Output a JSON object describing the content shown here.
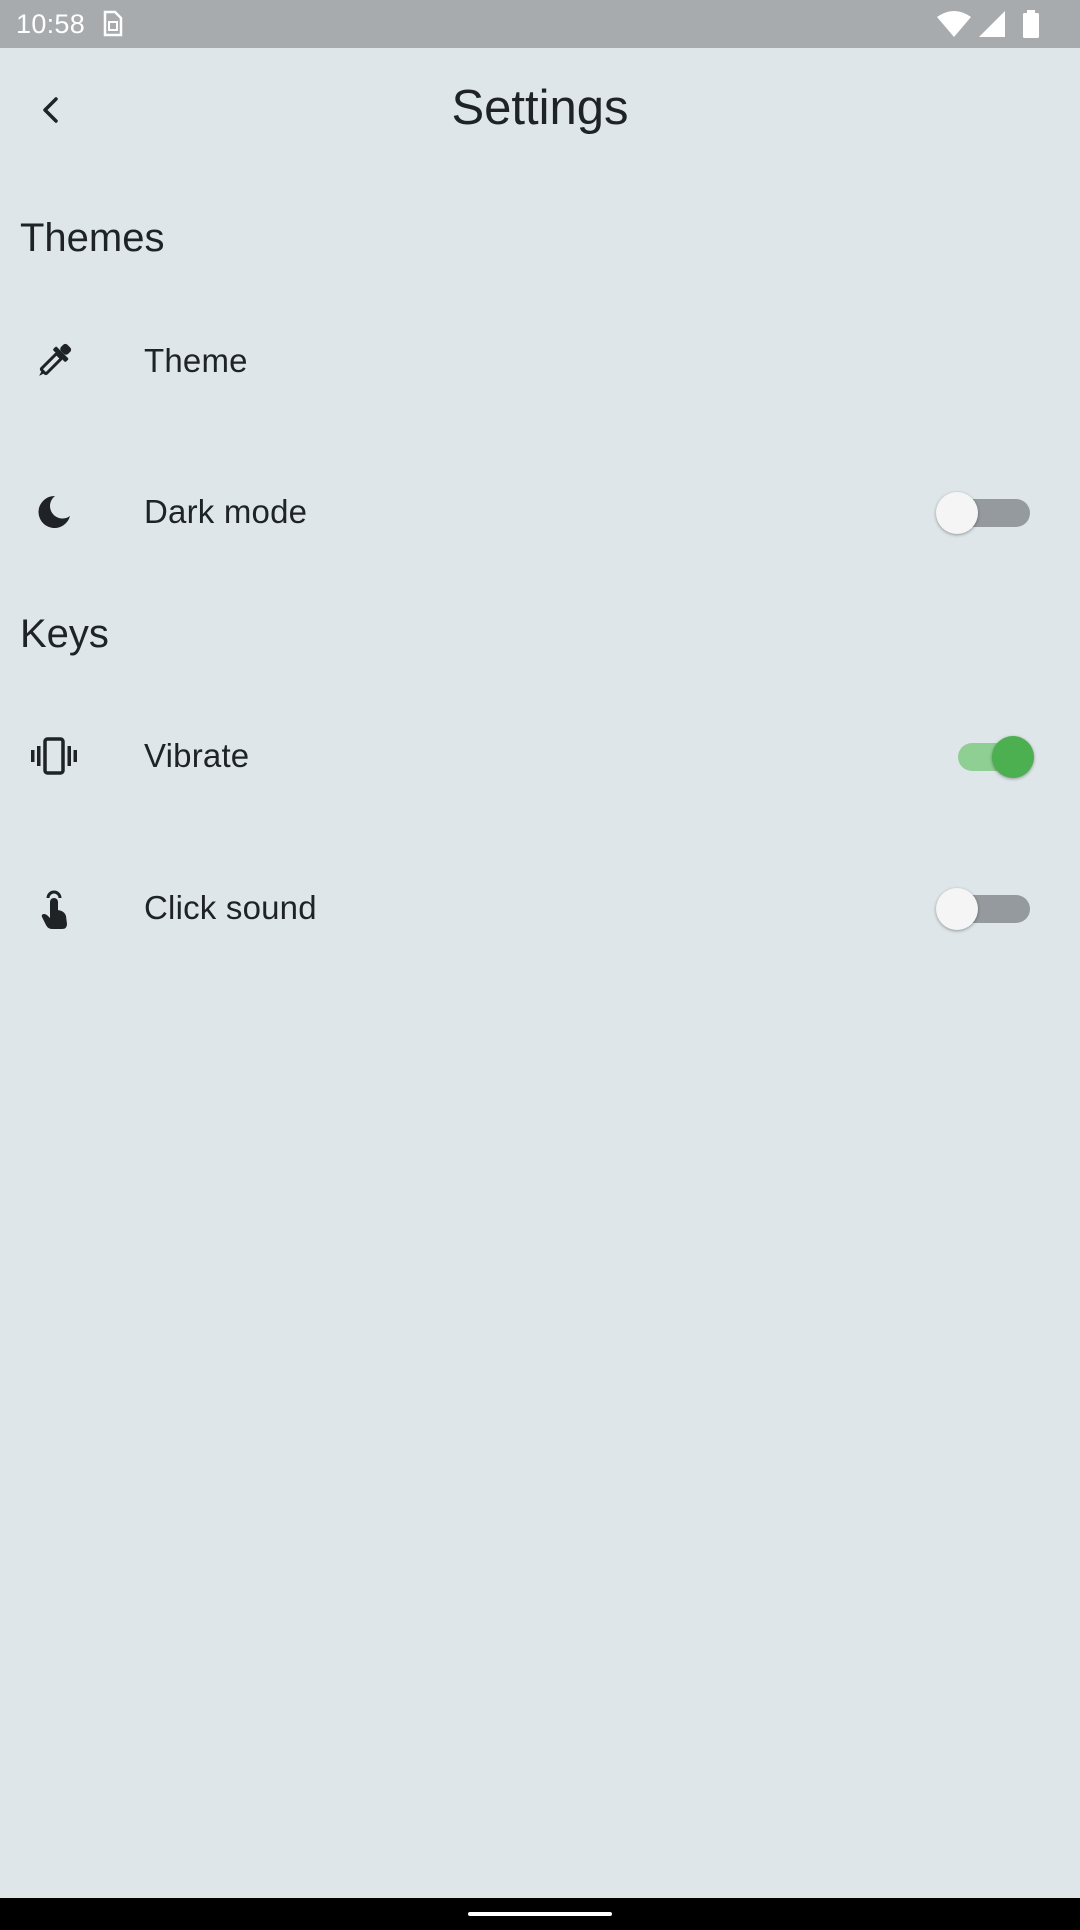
{
  "status_bar": {
    "time": "10:58",
    "icons": [
      "sim-card-icon",
      "wifi-icon",
      "signal-icon",
      "battery-icon"
    ]
  },
  "app_bar": {
    "title": "Settings",
    "back_icon": "chevron-left-icon"
  },
  "sections": [
    {
      "header": "Themes",
      "items": [
        {
          "label": "Theme",
          "icon": "eyedropper-icon"
        },
        {
          "label": "Dark mode",
          "icon": "moon-icon",
          "toggle": false
        }
      ]
    },
    {
      "header": "Keys",
      "items": [
        {
          "label": "Vibrate",
          "icon": "vibrate-icon",
          "toggle": true
        },
        {
          "label": "Click sound",
          "icon": "touch-icon",
          "toggle": false
        }
      ]
    }
  ],
  "colors": {
    "background": "#dee6e9",
    "status_bar": "#a7abae",
    "text": "#1f2326",
    "switch_on_thumb": "#4caf50",
    "switch_on_track": "#8fcf93",
    "switch_off_track": "#949a9e"
  }
}
